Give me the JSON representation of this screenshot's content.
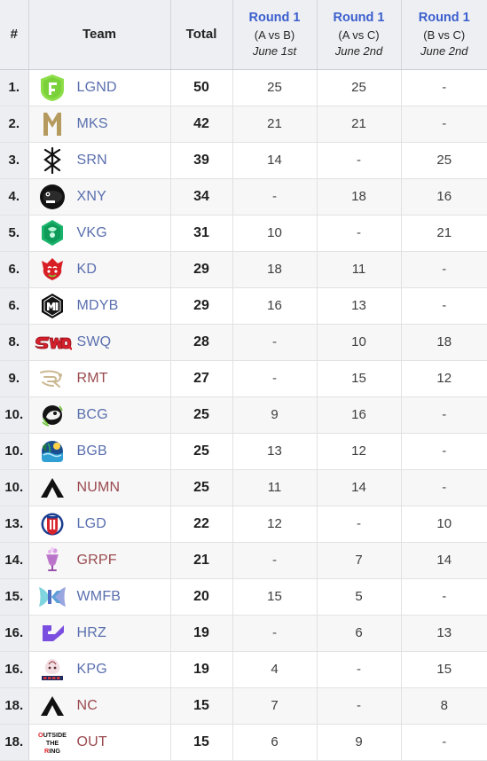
{
  "table": {
    "columns": [
      {
        "key": "rank",
        "label": "#",
        "type": "rank"
      },
      {
        "key": "team",
        "label": "Team",
        "type": "team"
      },
      {
        "key": "total",
        "label": "Total",
        "type": "total"
      },
      {
        "key": "r1ab",
        "label": "Round 1",
        "matchup": "(A vs B)",
        "date": "June 1st",
        "type": "score"
      },
      {
        "key": "r1ac",
        "label": "Round 1",
        "matchup": "(A vs C)",
        "date": "June 2nd",
        "type": "score"
      },
      {
        "key": "r1bc",
        "label": "Round 1",
        "matchup": "(B vs C)",
        "date": "June 2nd",
        "type": "score"
      }
    ],
    "rows": [
      {
        "rank": "1.",
        "team": "LGND",
        "logo": "lgnd",
        "color": "blue",
        "total": "50",
        "r1ab": "25",
        "r1ac": "25",
        "r1bc": "-"
      },
      {
        "rank": "2.",
        "team": "MKS",
        "logo": "mks",
        "color": "blue",
        "total": "42",
        "r1ab": "21",
        "r1ac": "21",
        "r1bc": "-"
      },
      {
        "rank": "3.",
        "team": "SRN",
        "logo": "srn",
        "color": "blue",
        "total": "39",
        "r1ab": "14",
        "r1ac": "-",
        "r1bc": "25"
      },
      {
        "rank": "4.",
        "team": "XNY",
        "logo": "xny",
        "color": "blue",
        "total": "34",
        "r1ab": "-",
        "r1ac": "18",
        "r1bc": "16"
      },
      {
        "rank": "5.",
        "team": "VKG",
        "logo": "vkg",
        "color": "blue",
        "total": "31",
        "r1ab": "10",
        "r1ac": "-",
        "r1bc": "21"
      },
      {
        "rank": "6.",
        "team": "KD",
        "logo": "kd",
        "color": "blue",
        "total": "29",
        "r1ab": "18",
        "r1ac": "11",
        "r1bc": "-"
      },
      {
        "rank": "6.",
        "team": "MDYB",
        "logo": "mdyb",
        "color": "blue",
        "total": "29",
        "r1ab": "16",
        "r1ac": "13",
        "r1bc": "-"
      },
      {
        "rank": "8.",
        "team": "SWQ",
        "logo": "swq",
        "color": "blue",
        "total": "28",
        "r1ab": "-",
        "r1ac": "10",
        "r1bc": "18"
      },
      {
        "rank": "9.",
        "team": "RMT",
        "logo": "rmt",
        "color": "red",
        "total": "27",
        "r1ab": "-",
        "r1ac": "15",
        "r1bc": "12"
      },
      {
        "rank": "10.",
        "team": "BCG",
        "logo": "bcg",
        "color": "blue",
        "total": "25",
        "r1ab": "9",
        "r1ac": "16",
        "r1bc": "-"
      },
      {
        "rank": "10.",
        "team": "BGB",
        "logo": "bgb",
        "color": "blue",
        "total": "25",
        "r1ab": "13",
        "r1ac": "12",
        "r1bc": "-"
      },
      {
        "rank": "10.",
        "team": "NUMN",
        "logo": "numn",
        "color": "red",
        "total": "25",
        "r1ab": "11",
        "r1ac": "14",
        "r1bc": "-"
      },
      {
        "rank": "13.",
        "team": "LGD",
        "logo": "lgd",
        "color": "blue",
        "total": "22",
        "r1ab": "12",
        "r1ac": "-",
        "r1bc": "10"
      },
      {
        "rank": "14.",
        "team": "GRPF",
        "logo": "grpf",
        "color": "red",
        "total": "21",
        "r1ab": "-",
        "r1ac": "7",
        "r1bc": "14"
      },
      {
        "rank": "15.",
        "team": "WMFB",
        "logo": "wmfb",
        "color": "blue",
        "total": "20",
        "r1ab": "15",
        "r1ac": "5",
        "r1bc": "-"
      },
      {
        "rank": "16.",
        "team": "HRZ",
        "logo": "hrz",
        "color": "blue",
        "total": "19",
        "r1ab": "-",
        "r1ac": "6",
        "r1bc": "13"
      },
      {
        "rank": "16.",
        "team": "KPG",
        "logo": "kpg",
        "color": "blue",
        "total": "19",
        "r1ab": "4",
        "r1ac": "-",
        "r1bc": "15"
      },
      {
        "rank": "18.",
        "team": "NC",
        "logo": "nc",
        "color": "red",
        "total": "15",
        "r1ab": "7",
        "r1ac": "-",
        "r1bc": "8"
      },
      {
        "rank": "18.",
        "team": "OUT",
        "logo": "out",
        "color": "red",
        "total": "15",
        "r1ab": "6",
        "r1ac": "9",
        "r1bc": "-"
      }
    ]
  },
  "colors": {
    "header_bg": "#eeeff3",
    "round_title": "#3a5fcd",
    "team_blue": "#5a6fae",
    "team_red": "#9a4a4f",
    "rank_bg": "#eceef2",
    "row_alt_bg": "#f7f7f7"
  }
}
